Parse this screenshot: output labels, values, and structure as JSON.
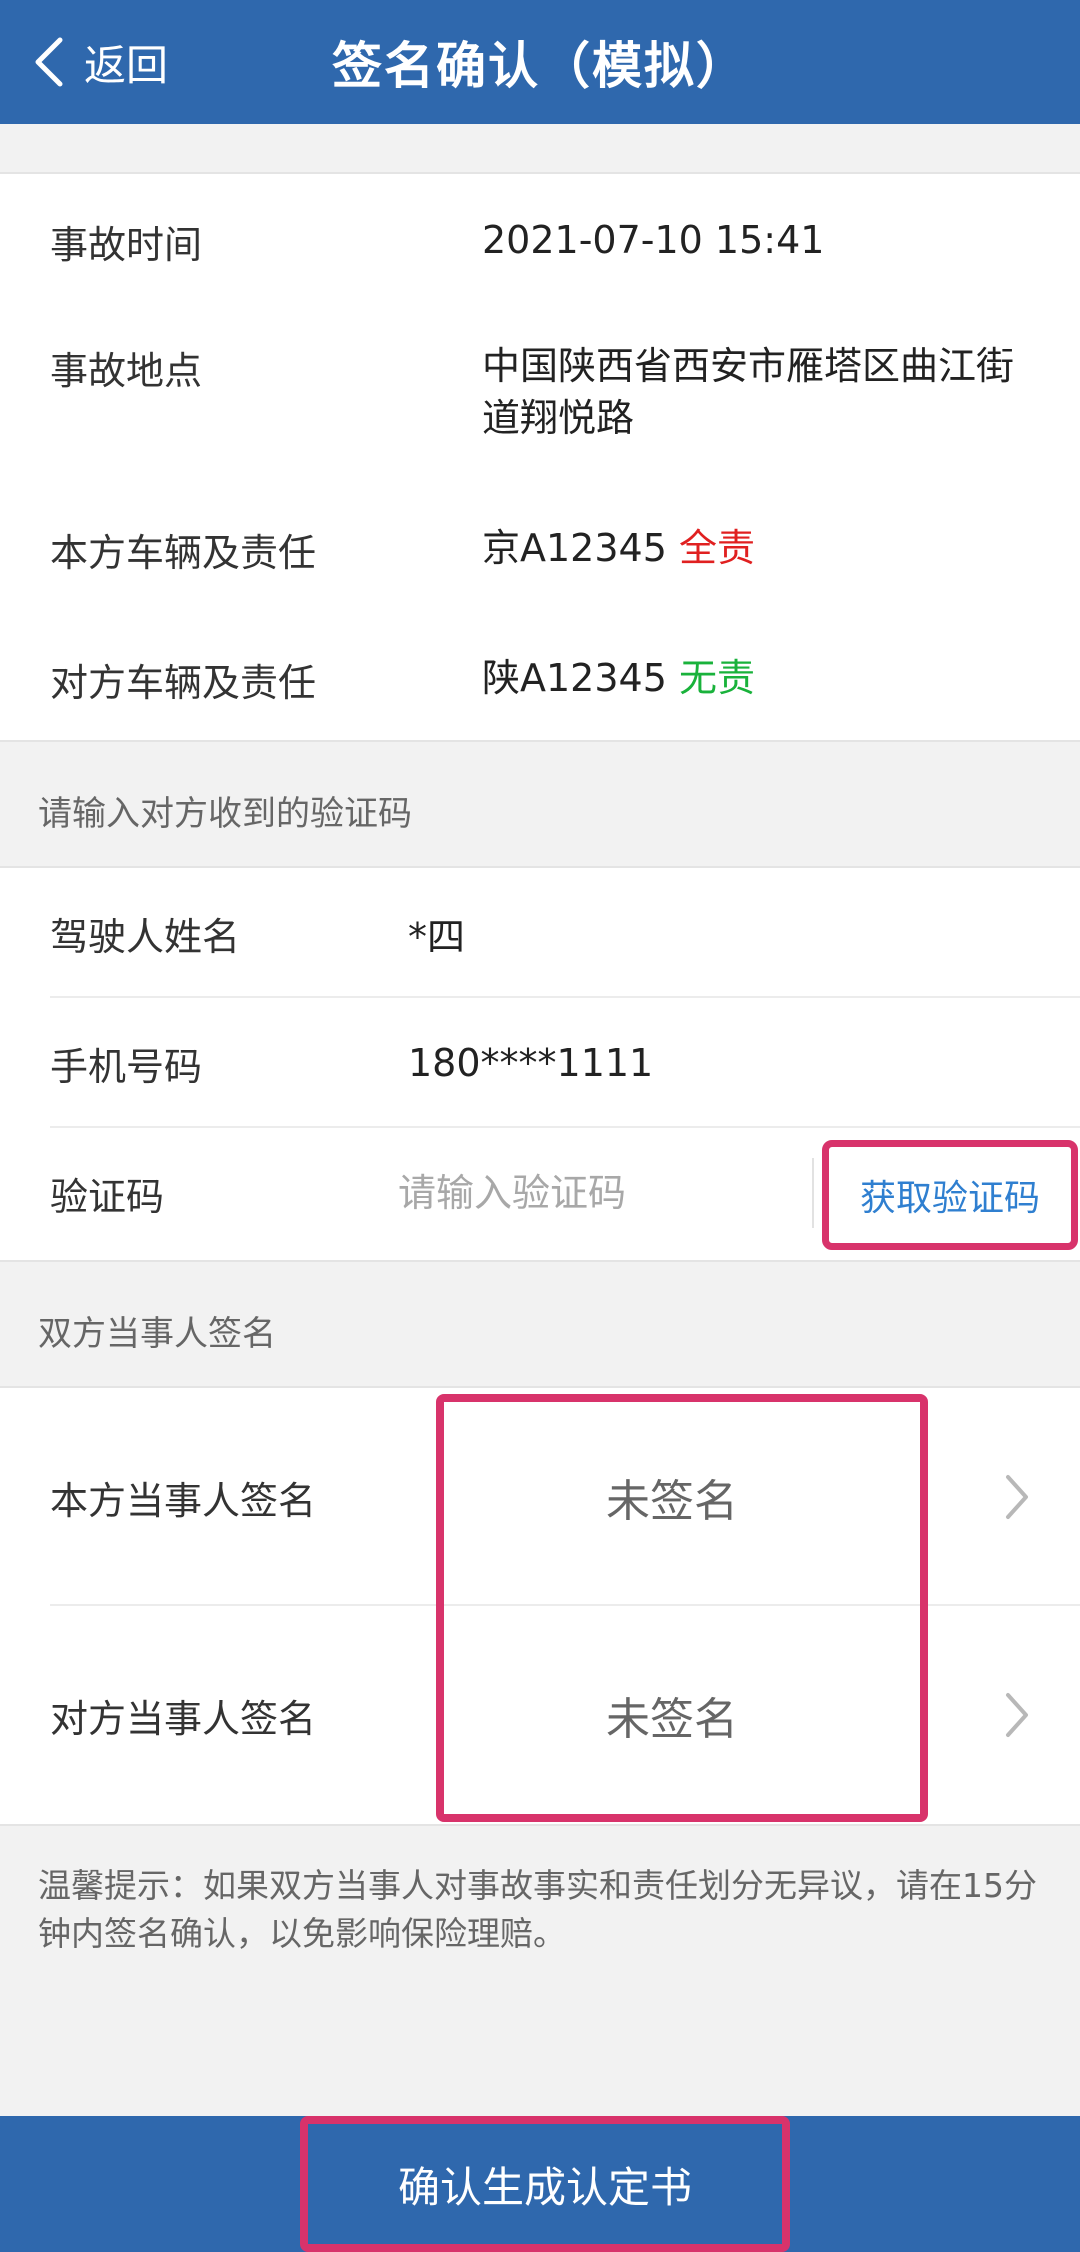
{
  "header": {
    "back_label": "返回",
    "title": "签名确认（模拟）"
  },
  "info": {
    "rows": [
      {
        "label": "事故时间",
        "value": "2021-07-10 15:41"
      },
      {
        "label": "事故地点",
        "value": "中国陕西省西安市雁塔区曲江街道翔悦路"
      },
      {
        "label": "本方车辆及责任",
        "plate": "京A12345",
        "liability": "全责",
        "liability_color": "#e02020"
      },
      {
        "label": "对方车辆及责任",
        "plate": "陕A12345",
        "liability": "无责",
        "liability_color": "#19b23b"
      }
    ]
  },
  "verify": {
    "section_title": "请输入对方收到的验证码",
    "driver_label": "驾驶人姓名",
    "driver_value": "*四",
    "phone_label": "手机号码",
    "phone_value": "180****1111",
    "code_label": "验证码",
    "code_placeholder": "请输入验证码",
    "get_code_label": "获取验证码"
  },
  "signatures": {
    "section_title": "双方当事人签名",
    "rows": [
      {
        "label": "本方当事人签名",
        "status": "未签名"
      },
      {
        "label": "对方当事人签名",
        "status": "未签名"
      }
    ]
  },
  "tips": "温馨提示：如果双方当事人对事故事实和责任划分无异议，请在15分钟内签名确认，以免影响保险理赔。",
  "footer": {
    "confirm_label": "确认生成认定书"
  },
  "colors": {
    "primary": "#2f68ad",
    "highlight": "#d8336b",
    "link": "#2f7fd0",
    "full_liability": "#e02020",
    "no_liability": "#19b23b"
  }
}
